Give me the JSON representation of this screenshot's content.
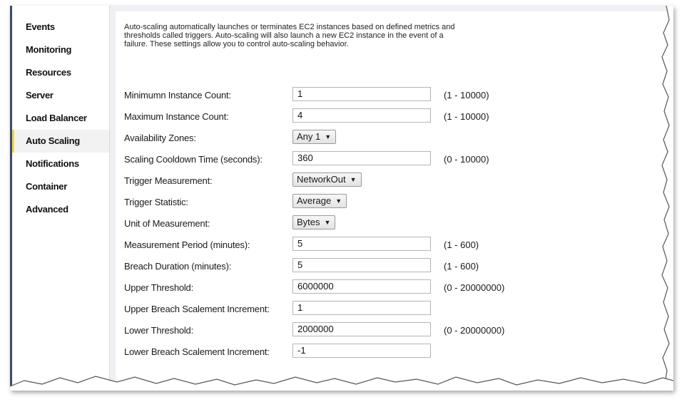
{
  "sidebar": {
    "items": [
      {
        "label": "Events",
        "active": false
      },
      {
        "label": "Monitoring",
        "active": false
      },
      {
        "label": "Resources",
        "active": false
      },
      {
        "label": "Server",
        "active": false
      },
      {
        "label": "Load Balancer",
        "active": false
      },
      {
        "label": "Auto Scaling",
        "active": true
      },
      {
        "label": "Notifications",
        "active": false
      },
      {
        "label": "Container",
        "active": false
      },
      {
        "label": "Advanced",
        "active": false
      }
    ]
  },
  "description": "Auto-scaling automatically launches or terminates EC2 instances based on defined metrics and thresholds called triggers. Auto-scaling will also launch a new EC2 instance in the event of a failure. These settings allow you to control auto-scaling behavior.",
  "fields": [
    {
      "label": "Minimumn Instance Count:",
      "value": "1",
      "range": "(1 - 10000)"
    },
    {
      "label": "Maximum Instance Count:",
      "value": "4",
      "range": "(1 - 10000)"
    },
    {
      "label": "Availability Zones:",
      "select": "Any 1"
    },
    {
      "label": "Scaling Cooldown Time (seconds):",
      "value": "360",
      "range": "(0 - 10000)"
    },
    {
      "label": "Trigger Measurement:",
      "select": "NetworkOut"
    },
    {
      "label": "Trigger Statistic:",
      "select": "Average"
    },
    {
      "label": "Unit of Measurement:",
      "select": "Bytes"
    },
    {
      "label": "Measurement Period (minutes):",
      "value": "5",
      "range": "(1 - 600)"
    },
    {
      "label": "Breach Duration (minutes):",
      "value": "5",
      "range": "(1 - 600)"
    },
    {
      "label": "Upper Threshold:",
      "value": "6000000",
      "range": "(0 - 20000000)"
    },
    {
      "label": "Upper Breach Scalement Increment:",
      "value": "1"
    },
    {
      "label": "Lower Threshold:",
      "value": "2000000",
      "range": "(0 - 20000000)"
    },
    {
      "label": "Lower Breach Scalement Increment:",
      "value": "-1"
    }
  ],
  "colors": {
    "active_marker": "#f2d94a",
    "left_edge": "#3b4b6a"
  }
}
